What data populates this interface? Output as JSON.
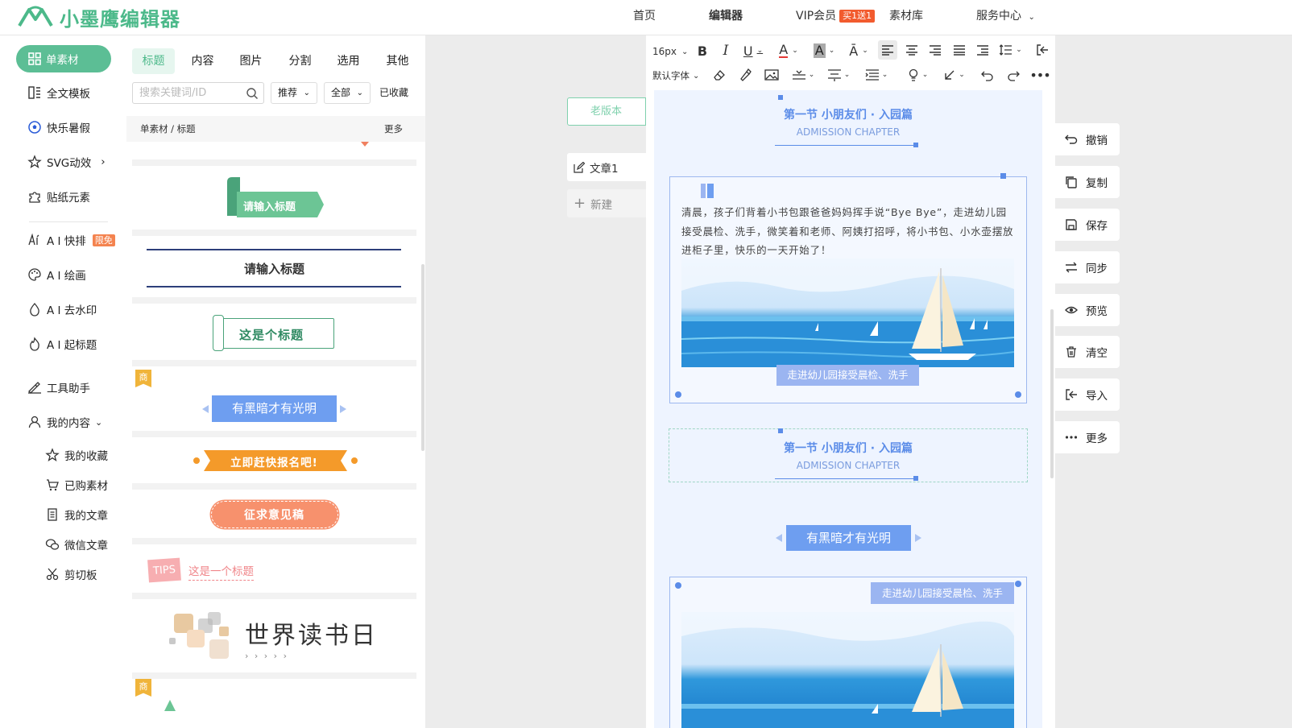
{
  "header": {
    "logo_text": "小墨鹰编辑器",
    "nav": [
      {
        "label": "首页"
      },
      {
        "label": "编辑器"
      },
      {
        "label": "VIP会员",
        "badge": "买1送1"
      },
      {
        "label": "素材库"
      },
      {
        "label": "服务中心"
      }
    ]
  },
  "leftnav": {
    "single_material": "单素材",
    "items": [
      {
        "label": "全文模板",
        "icon": "template-icon"
      },
      {
        "label": "快乐暑假",
        "icon": "soccer-ball-icon"
      },
      {
        "label": "SVG动效",
        "icon": "star-icon"
      },
      {
        "label": "贴纸元素",
        "icon": "puzzle-icon"
      },
      {
        "label": "A I 快排",
        "icon": "ai-icon",
        "badge": "限免"
      },
      {
        "label": "A I 绘画",
        "icon": "palette-icon"
      },
      {
        "label": "A I 去水印",
        "icon": "drop-icon"
      },
      {
        "label": "A I 起标题",
        "icon": "flame-icon"
      },
      {
        "label": "工具助手",
        "icon": "tool-icon"
      },
      {
        "label": "我的内容",
        "icon": "user-icon"
      }
    ],
    "sub_items": [
      {
        "label": "我的收藏",
        "icon": "star-icon"
      },
      {
        "label": "已购素材",
        "icon": "cart-icon"
      },
      {
        "label": "我的文章",
        "icon": "document-icon"
      },
      {
        "label": "微信文章",
        "icon": "wechat-icon"
      },
      {
        "label": "剪切板",
        "icon": "scissors-icon"
      }
    ]
  },
  "panel": {
    "tabs": [
      "标题",
      "内容",
      "图片",
      "分割",
      "选用",
      "其他"
    ],
    "search_placeholder": "搜索关键词/ID",
    "filters": {
      "sort": "推荐",
      "scope": "全部",
      "favorites": "已收藏"
    },
    "breadcrumb": "单素材 / 标题",
    "more": "更多",
    "cards": [
      {
        "text": "请输入标题"
      },
      {
        "text": "请输入标题"
      },
      {
        "text": "这是个标题"
      },
      {
        "text": "有黑暗才有光明",
        "badge": "商"
      },
      {
        "text": "立即赶快报名吧!"
      },
      {
        "text": "征求意见稿"
      },
      {
        "tag": "TIPS",
        "text": "这是一个标题"
      },
      {
        "text": "世界读书日",
        "sub": "› › › › ›"
      },
      {
        "badge": "商"
      }
    ]
  },
  "middle": {
    "old_version": "老版本",
    "article": "文章1",
    "new": "新建"
  },
  "toolbar": {
    "font_size": "16px",
    "font_family": "默认字体"
  },
  "document": {
    "section1": {
      "title": "第一节 小朋友们 · 入园篇",
      "subtitle": "ADMISSION CHAPTER"
    },
    "paragraph": "清晨，孩子们背着小书包跟爸爸妈妈挥手说“Bye Bye”，走进幼儿园接受晨检、洗手，微笑着和老师、阿姨打招呼，将小书包、小水壶摆放进柜子里，快乐的一天开始了！",
    "caption1": "走进幼儿园接受晨检、洗手",
    "section2": {
      "title": "第一节 小朋友们 · 入园篇",
      "subtitle": "ADMISSION CHAPTER"
    },
    "blue_title": "有黑暗才有光明",
    "caption2": "走进幼儿园接受晨检、洗手"
  },
  "right_tools": [
    "撤销",
    "复制",
    "保存",
    "同步",
    "预览",
    "清空",
    "导入",
    "更多"
  ]
}
